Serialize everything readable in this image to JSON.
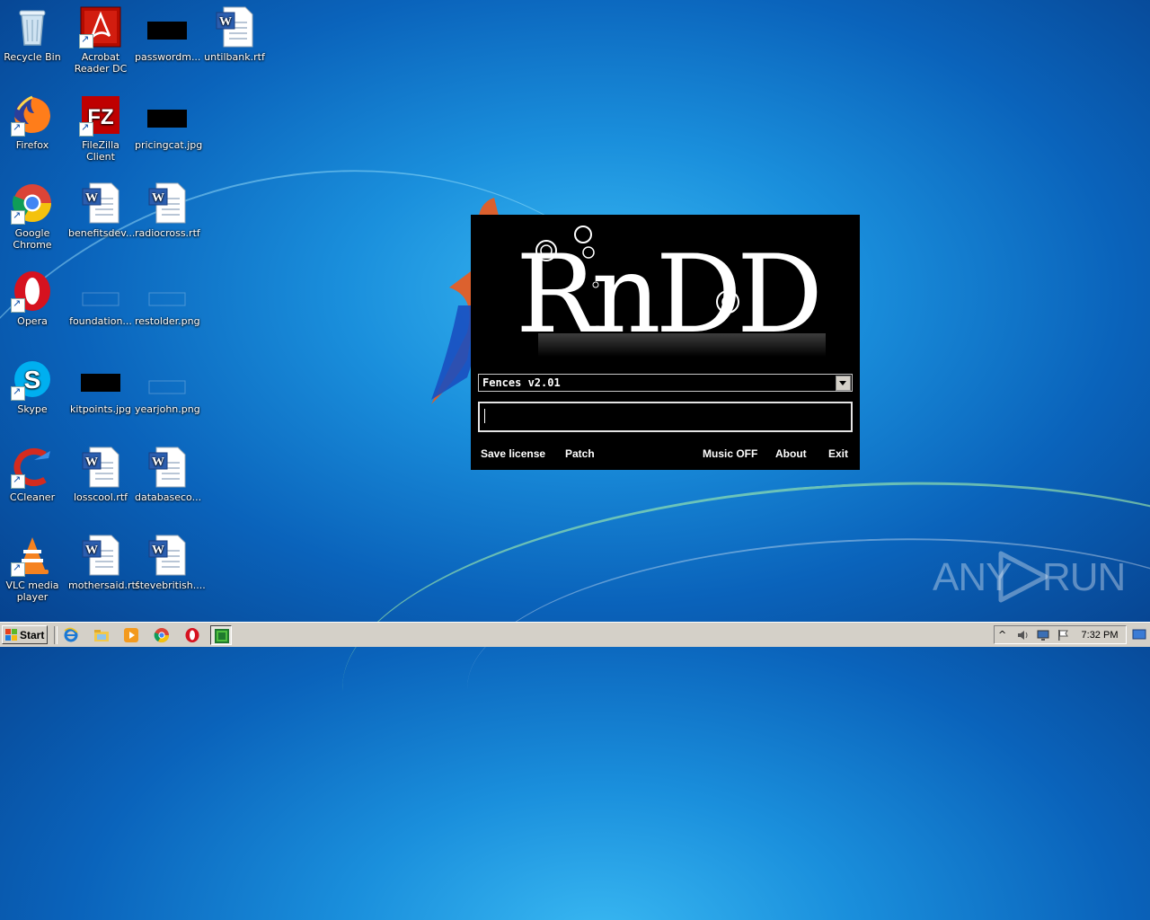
{
  "desktop": {
    "icons": [
      {
        "label": "Recycle Bin",
        "icon": "recycle-bin-icon",
        "shortcut": false
      },
      {
        "label": "Acrobat Reader DC",
        "icon": "acrobat-icon",
        "shortcut": true
      },
      {
        "label": "passwordm...",
        "icon": "image-thumbnail-icon",
        "shortcut": false
      },
      {
        "label": "untilbank.rtf",
        "icon": "word-document-icon",
        "shortcut": false
      },
      {
        "label": "Firefox",
        "icon": "firefox-icon",
        "shortcut": true
      },
      {
        "label": "FileZilla Client",
        "icon": "filezilla-icon",
        "shortcut": true
      },
      {
        "label": "pricingcat.jpg",
        "icon": "image-thumbnail-icon",
        "shortcut": false
      },
      {
        "label": "Google Chrome",
        "icon": "chrome-icon",
        "shortcut": true
      },
      {
        "label": "benefitsdev...",
        "icon": "word-document-icon",
        "shortcut": false
      },
      {
        "label": "radiocross.rtf",
        "icon": "word-document-icon",
        "shortcut": false
      },
      {
        "label": "Opera",
        "icon": "opera-icon",
        "shortcut": true
      },
      {
        "label": "foundation...",
        "icon": "image-thumbnail-icon",
        "shortcut": false
      },
      {
        "label": "restolder.png",
        "icon": "image-thumbnail-icon",
        "shortcut": false
      },
      {
        "label": "Skype",
        "icon": "skype-icon",
        "shortcut": true
      },
      {
        "label": "kitpoints.jpg",
        "icon": "image-thumbnail-icon",
        "shortcut": false
      },
      {
        "label": "yearjohn.png",
        "icon": "image-thumbnail-icon",
        "shortcut": false
      },
      {
        "label": "CCleaner",
        "icon": "ccleaner-icon",
        "shortcut": true
      },
      {
        "label": "losscool.rtf",
        "icon": "word-document-icon",
        "shortcut": false
      },
      {
        "label": "databaseco...",
        "icon": "word-document-icon",
        "shortcut": false
      },
      {
        "label": "VLC media player",
        "icon": "vlc-icon",
        "shortcut": true
      },
      {
        "label": "mothersaid.rtf",
        "icon": "word-document-icon",
        "shortcut": false
      },
      {
        "label": "stevebritish....",
        "icon": "word-document-icon",
        "shortcut": false
      }
    ]
  },
  "dialog": {
    "logo_text": "RnDD",
    "product_select": "Fences v2.01",
    "license_key_value": "",
    "buttons": {
      "save_license": "Save license",
      "patch": "Patch",
      "music": "Music OFF",
      "about": "About",
      "exit": "Exit"
    }
  },
  "watermark": {
    "left": "ANY",
    "right": "RUN"
  },
  "taskbar": {
    "start_label": "Start",
    "pinned": [
      "internet-explorer-icon",
      "file-explorer-icon",
      "media-player-icon",
      "chrome-icon",
      "opera-icon",
      "rndd-keygen-icon"
    ],
    "clock": "7:32 PM"
  },
  "colors": {
    "desktop_blue": "#1a8fdc",
    "dialog_bg": "#000000",
    "taskbar_bg": "#d4d0c8"
  }
}
